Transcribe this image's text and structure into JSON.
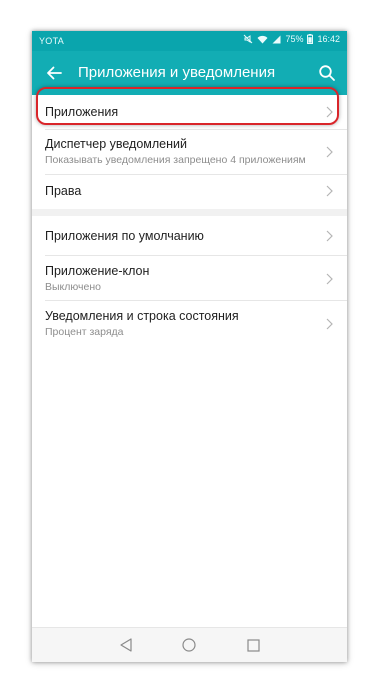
{
  "status_bar": {
    "carrier": "YOTA",
    "battery": "75%",
    "time": "16:42"
  },
  "app_bar": {
    "title": "Приложения и уведомления"
  },
  "menu": {
    "items": [
      {
        "title": "Приложения"
      },
      {
        "title": "Диспетчер уведомлений",
        "subtitle": "Показывать уведомления запрещено 4 приложениям"
      },
      {
        "title": "Права"
      },
      {
        "title": "Приложения по умолчанию"
      },
      {
        "title": "Приложение-клон",
        "subtitle": "Выключено"
      },
      {
        "title": "Уведомления и строка состояния",
        "subtitle": "Процент заряда"
      }
    ]
  },
  "colors": {
    "accent": "#12adb4",
    "status_bar": "#0aa5ad",
    "highlight": "#d9252a"
  },
  "icons": [
    "back-arrow-icon",
    "search-icon",
    "chevron-right-icon",
    "nav-back-icon",
    "nav-home-icon",
    "nav-recents-icon",
    "mute-icon",
    "wifi-icon",
    "signal-icon",
    "battery-icon"
  ]
}
